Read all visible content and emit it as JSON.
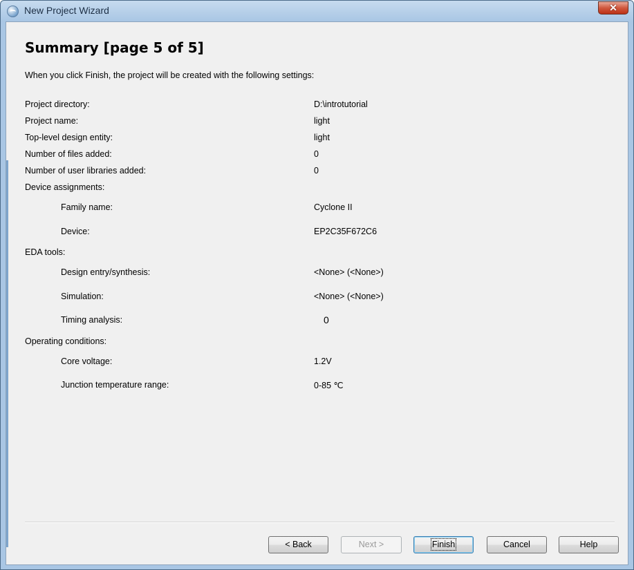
{
  "window": {
    "title": "New Project Wizard",
    "close_label": "✕"
  },
  "page": {
    "title": "Summary [page 5 of 5]",
    "intro": "When you click Finish, the project will be created with the following settings:"
  },
  "settings": [
    {
      "label": "Project directory:",
      "value": "D:\\introtutorial"
    },
    {
      "label": "Project name:",
      "value": "light"
    },
    {
      "label": "Top-level design entity:",
      "value": "light"
    },
    {
      "label": "Number of files added:",
      "value": "0"
    },
    {
      "label": "Number of user libraries added:",
      "value": "0"
    },
    {
      "label": "Device assignments:",
      "value": ""
    },
    {
      "label": "Family name:",
      "value": "Cyclone II"
    },
    {
      "label": "Device:",
      "value": "EP2C35F672C6"
    },
    {
      "label": "EDA tools:",
      "value": ""
    },
    {
      "label": "Design entry/synthesis:",
      "value": "<None> (<None>)"
    },
    {
      "label": "Simulation:",
      "value": "<None> (<None>)"
    },
    {
      "label": "Timing analysis:",
      "value": "0"
    },
    {
      "label": "Operating conditions:",
      "value": ""
    },
    {
      "label": "Core voltage:",
      "value": "1.2V"
    },
    {
      "label": "Junction temperature range:",
      "value": "0-85 ℃"
    }
  ],
  "buttons": {
    "back": "< Back",
    "next": "Next >",
    "finish": "Finish",
    "cancel": "Cancel",
    "help": "Help"
  }
}
